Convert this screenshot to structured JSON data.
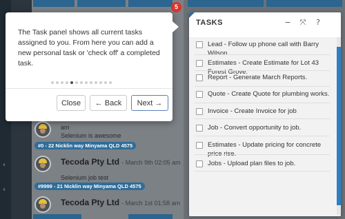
{
  "tour": {
    "text": "The Task panel shows all current tasks assigned to you. From here you can add a new personal task or 'check off' a completed task.",
    "step_badge": "5",
    "dots_total": 13,
    "dots_active_index": 4,
    "close_label": "Close",
    "back_label": "← Back",
    "next_label": "Next →"
  },
  "tasks_panel": {
    "title": "TASKS",
    "minimize_icon": "−",
    "expand_icon": "⤧",
    "help_icon": "?",
    "items": [
      {
        "label": "Lead - Follow up phone call with Barry Wilson."
      },
      {
        "label": "Estimates - Create Estimate for Lot 43 Forest Grove."
      },
      {
        "label": "Report - Generate March Reports."
      },
      {
        "label": "Quote - Create Quote for plumbing works."
      },
      {
        "label": "Invoice - Create Invoice for job"
      },
      {
        "label": "Job - Convert opportunity to job."
      },
      {
        "label": "Estimates - Update pricing for concrete price rise."
      },
      {
        "label": "Jobs - Upload plan files to job."
      }
    ]
  },
  "feed": {
    "items": [
      {
        "name": "",
        "time": "am",
        "text": "Selenium is awesome",
        "tag": "#0 - 22 Nicklin way Minyama QLD 4575"
      },
      {
        "name": "Tecoda Pty Ltd",
        "time": "- March 9th 02:05 am",
        "text": "Selenium job test",
        "tag": "#9999 - 21 Nicklin way Minyama QLD 4575"
      },
      {
        "name": "Tecoda Pty Ltd",
        "time": "- March 1st 01:58 am",
        "text": "",
        "tag": ""
      }
    ]
  },
  "colors": {
    "accent": "#2f6d99",
    "badge": "#d9342b",
    "scroll_thumb": "#2f7fc0"
  }
}
